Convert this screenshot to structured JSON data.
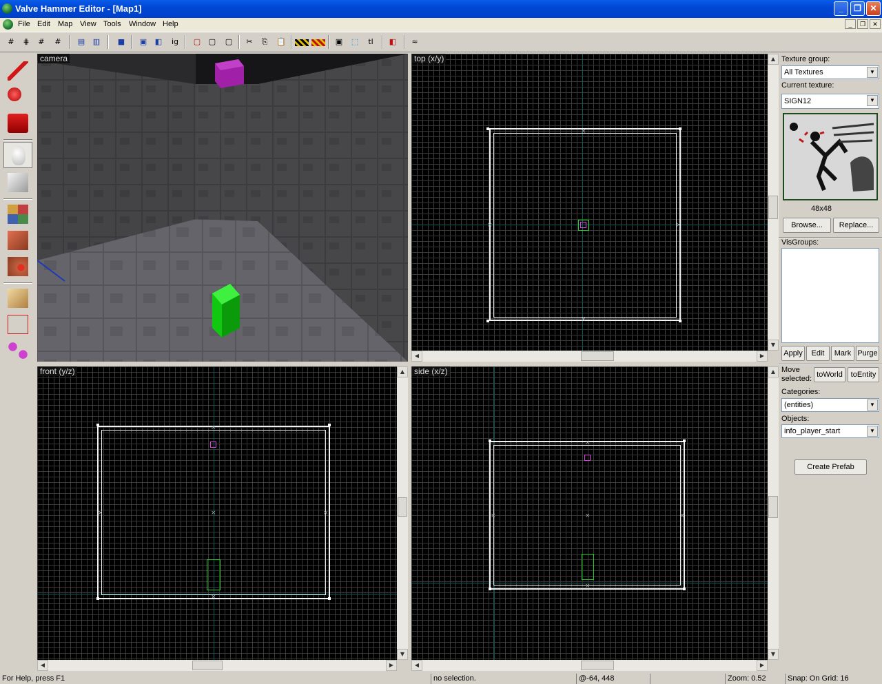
{
  "window": {
    "title": "Valve Hammer Editor - [Map1]"
  },
  "menu": {
    "file": "File",
    "edit": "Edit",
    "map": "Map",
    "view": "View",
    "tools": "Tools",
    "window": "Window",
    "help": "Help"
  },
  "toolbar": {
    "ig_label": "ig",
    "tl_label": "tl"
  },
  "views": {
    "camera": "camera",
    "top": "top (x/y)",
    "front": "front (y/z)",
    "side": "side (x/z)"
  },
  "panel": {
    "texture_group_label": "Texture group:",
    "texture_group_value": "All Textures",
    "current_texture_label": "Current texture:",
    "current_texture_value": "SIGN12",
    "texture_size": "48x48",
    "browse": "Browse...",
    "replace": "Replace...",
    "visgroups_label": "VisGroups:",
    "apply": "Apply",
    "edit": "Edit",
    "mark": "Mark",
    "purge": "Purge",
    "move_selected": "Move selected:",
    "to_world": "toWorld",
    "to_entity": "toEntity",
    "categories_label": "Categories:",
    "categories_value": "(entities)",
    "objects_label": "Objects:",
    "objects_value": "info_player_start",
    "create_prefab": "Create Prefab"
  },
  "status": {
    "help": "For Help, press F1",
    "selection": "no selection.",
    "coords": "@-64, 448",
    "zoom": "Zoom: 0.52",
    "snap": "Snap: On Grid: 16"
  },
  "colors": {
    "titlebar": "#0047d6",
    "grid_bg": "#000000",
    "brush_wire": "#f2f2f2",
    "entity_magenta": "#e040e0",
    "entity_green": "#2ad02a"
  }
}
